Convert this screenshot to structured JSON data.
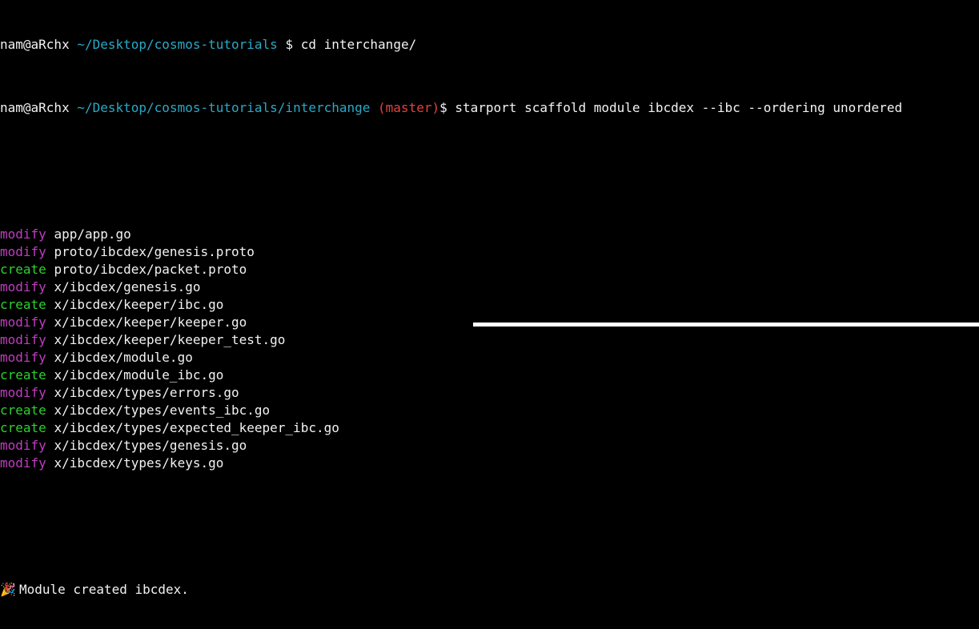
{
  "terminal": {
    "previous_prompt": {
      "user": "nam@aRchx",
      "path": "~/Desktop/cosmos-tutorials",
      "symbol": "$",
      "command": "cd interchange/"
    },
    "prompt": {
      "user": "nam@aRchx",
      "path": "~/Desktop/cosmos-tutorials/interchange",
      "branch": "(master)",
      "symbol": "$",
      "command": "starport scaffold module ibcdex --ibc --ordering unordered"
    },
    "output": [
      {
        "action": "modify",
        "file": "app/app.go"
      },
      {
        "action": "modify",
        "file": "proto/ibcdex/genesis.proto"
      },
      {
        "action": "create",
        "file": "proto/ibcdex/packet.proto"
      },
      {
        "action": "modify",
        "file": "x/ibcdex/genesis.go"
      },
      {
        "action": "create",
        "file": "x/ibcdex/keeper/ibc.go"
      },
      {
        "action": "modify",
        "file": "x/ibcdex/keeper/keeper.go"
      },
      {
        "action": "modify",
        "file": "x/ibcdex/keeper/keeper_test.go"
      },
      {
        "action": "modify",
        "file": "x/ibcdex/module.go"
      },
      {
        "action": "create",
        "file": "x/ibcdex/module_ibc.go"
      },
      {
        "action": "modify",
        "file": "x/ibcdex/types/errors.go"
      },
      {
        "action": "create",
        "file": "x/ibcdex/types/events_ibc.go"
      },
      {
        "action": "create",
        "file": "x/ibcdex/types/expected_keeper_ibc.go"
      },
      {
        "action": "modify",
        "file": "x/ibcdex/types/genesis.go"
      },
      {
        "action": "modify",
        "file": "x/ibcdex/types/keys.go"
      }
    ],
    "result": {
      "icon": "party-popper-icon",
      "icon_glyph": "🎉",
      "message": "Module created ibcdex."
    }
  },
  "colors": {
    "background": "#000000",
    "text": "#f2f2f2",
    "path": "#2aa9c7",
    "branch": "#e0443e",
    "modify": "#bf3dbf",
    "create": "#2ed12e"
  }
}
